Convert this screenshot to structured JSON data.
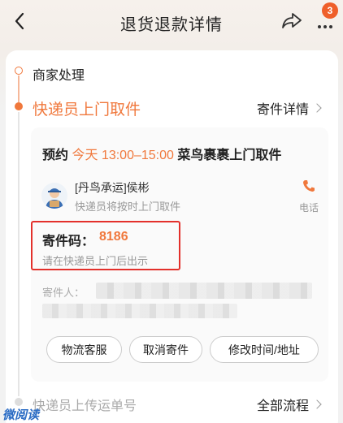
{
  "header": {
    "title": "退货退款详情",
    "badge_count": "3",
    "icons": {
      "back": "chevron-left-icon",
      "share": "share-icon",
      "more": "more-dots-icon"
    }
  },
  "timeline": {
    "step1": "商家处理",
    "step2": "快递员上门取件",
    "step2_link": "寄件详情",
    "step3": "快递员上传运单号",
    "step3_link": "全部流程"
  },
  "pickup": {
    "prefix": "预约",
    "day": "今天",
    "time": "13:00–15:00",
    "suffix": "菜鸟裹裹上门取件",
    "courier_name": "[丹鸟承运]侯彬",
    "courier_note": "快递员将按时上门取件",
    "phone_label": "电话",
    "code_label": "寄件码：",
    "code_value": "8186",
    "code_hint": "请在快递员上门后出示",
    "sender_label": "寄件人："
  },
  "actions": {
    "customer_service": "物流客服",
    "cancel": "取消寄件",
    "modify": "修改时间/地址"
  },
  "watermark": "微阅读",
  "colors": {
    "accent": "#f0783c",
    "highlight_box": "#e3302b",
    "badge": "#ef5f2a"
  }
}
